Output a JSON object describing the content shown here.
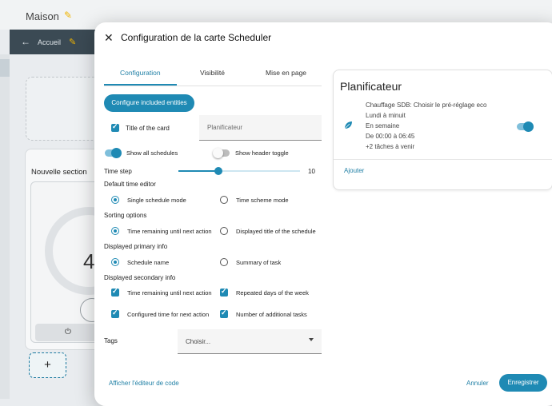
{
  "background": {
    "dashboard_title": "Maison",
    "breadcrumb": "Accueil",
    "section_title": "Nouvelle section",
    "gauge_value": "4",
    "add_label": "+"
  },
  "dialog": {
    "title": "Configuration de la carte Scheduler",
    "tabs": [
      "Configuration",
      "Visibilité",
      "Mise en page"
    ],
    "active_tab": 0,
    "include_button": "Configure included entities",
    "title_checkbox_label": "Title of the card",
    "title_placeholder": "Planificateur",
    "show_all_label": "Show all schedules",
    "show_header_label": "Show header toggle",
    "time_step_label": "Time step",
    "time_step_value": "10",
    "time_step_fraction": 0.33,
    "default_editor_label": "Default time editor",
    "editor_opt1": "Single schedule mode",
    "editor_opt2": "Time scheme mode",
    "sorting_label": "Sorting options",
    "sort_opt1": "Time remaining until next action",
    "sort_opt2": "Displayed title of the schedule",
    "primary_label": "Displayed primary info",
    "primary_opt1": "Schedule name",
    "primary_opt2": "Summary of task",
    "secondary_label": "Displayed secondary info",
    "sec_opt1": "Time remaining until next action",
    "sec_opt2": "Repeated days of the week",
    "sec_opt3": "Configured time for next action",
    "sec_opt4": "Number of additional tasks",
    "tags_label": "Tags",
    "tags_placeholder": "Choisir...",
    "code_editor_link": "Afficher l'éditeur de code",
    "cancel": "Annuler",
    "save": "Enregistrer",
    "accent_color": "#1f8ab4"
  },
  "preview": {
    "title": "Planificateur",
    "line1": "Chauffage SDB: Choisir le pré-réglage eco",
    "line2": "Lundi à minuit",
    "line3": "En semaine",
    "line4": "De 00:00 à 06:45",
    "line5": "+2 tâches à venir",
    "add": "Ajouter",
    "icon": "leaf-icon"
  }
}
